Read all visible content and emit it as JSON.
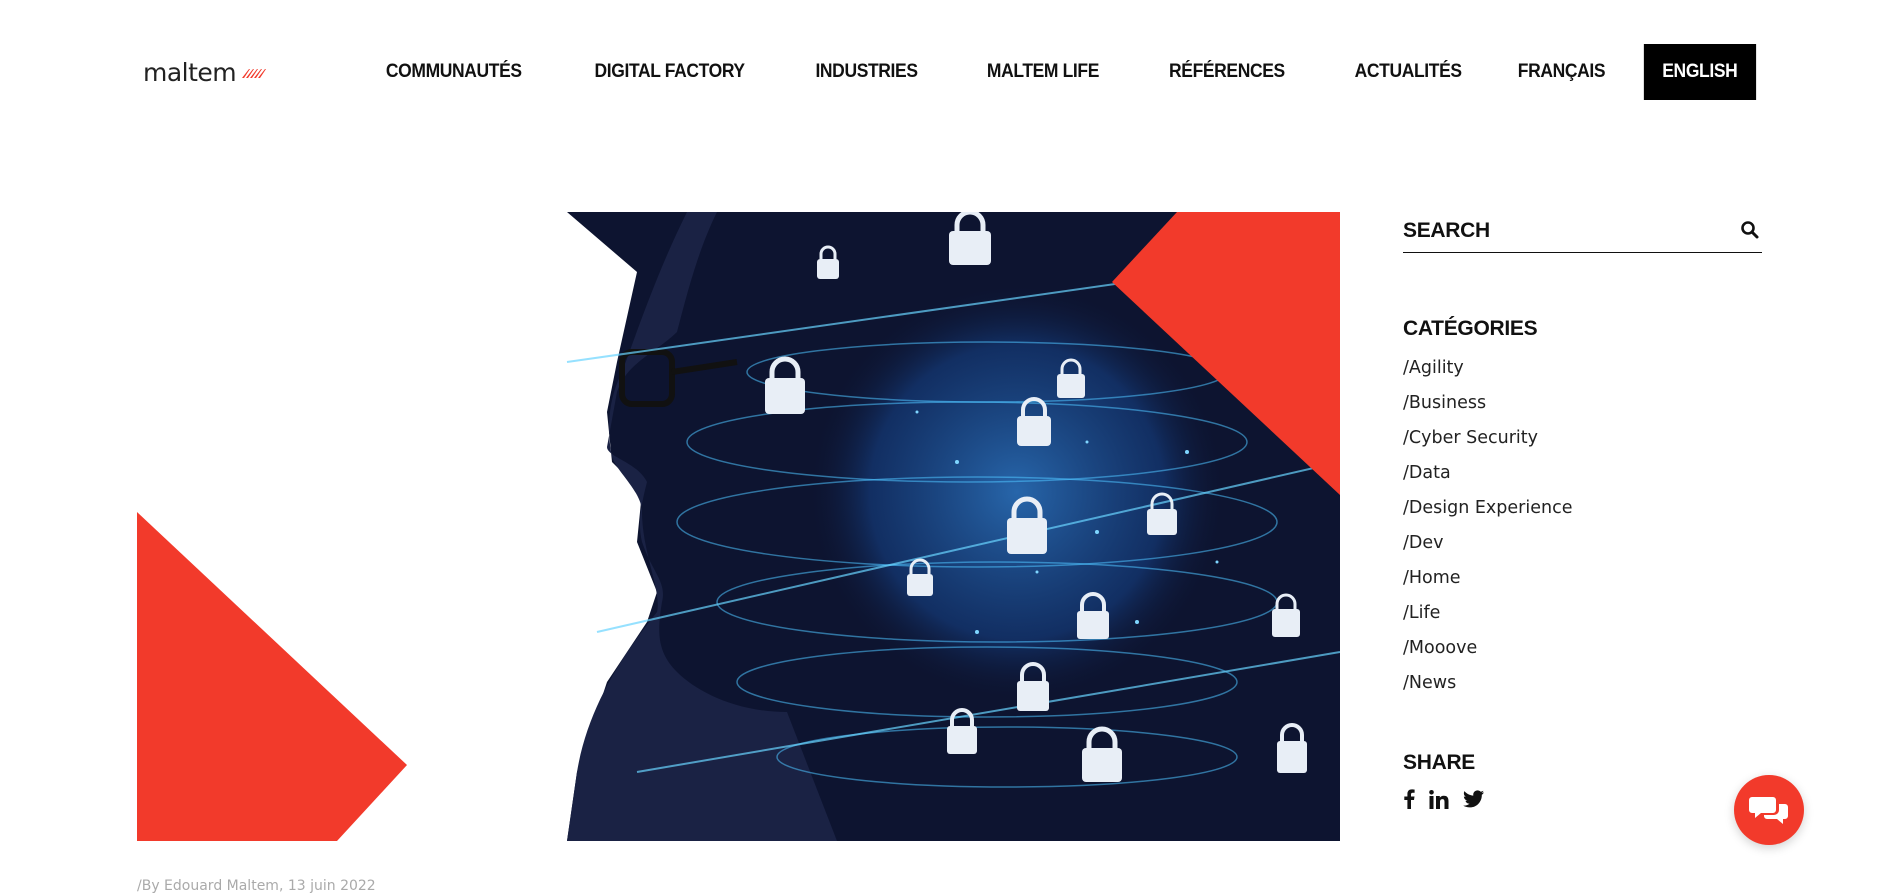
{
  "brand": {
    "logo_text": "maltem",
    "accent_color": "#f23a2b"
  },
  "nav": {
    "items": [
      {
        "label": "COMMUNAUTÉS"
      },
      {
        "label": "DIGITAL FACTORY"
      },
      {
        "label": "INDUSTRIES"
      },
      {
        "label": "MALTEM LIFE"
      },
      {
        "label": "RÉFÉRENCES"
      },
      {
        "label": "ACTUALITÉS"
      }
    ],
    "lang_fr": "FRANÇAIS",
    "lang_en": "ENGLISH"
  },
  "hero": {
    "image_icon": "cyber-security-image",
    "colors": {
      "accent": "#f23a2b",
      "dark": "#0d1430",
      "glow": "#4fc3ff"
    }
  },
  "sidebar": {
    "search": {
      "placeholder": "SEARCH",
      "icon": "search-icon"
    },
    "categories_title": "CATÉGORIES",
    "categories": [
      {
        "label": "/Agility"
      },
      {
        "label": "/Business"
      },
      {
        "label": "/Cyber Security"
      },
      {
        "label": "/Data"
      },
      {
        "label": "/Design Experience"
      },
      {
        "label": "/Dev"
      },
      {
        "label": "/Home"
      },
      {
        "label": "/Life"
      },
      {
        "label": "/Mooove"
      },
      {
        "label": "/News"
      }
    ],
    "share_title": "SHARE",
    "share": [
      {
        "icon": "facebook-icon"
      },
      {
        "icon": "linkedin-icon"
      },
      {
        "icon": "twitter-icon"
      }
    ]
  },
  "chat": {
    "icon": "chat-icon"
  },
  "meta": {
    "line": "/By Edouard Maltem, 13 juin 2022"
  }
}
